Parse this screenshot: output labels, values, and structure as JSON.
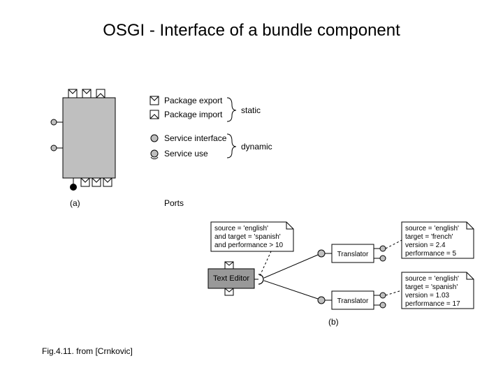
{
  "title": "OSGI - Interface of a bundle component",
  "legend": {
    "pkg_export": "Package export",
    "pkg_import": "Package import",
    "svc_interface": "Service interface",
    "svc_use": "Service use",
    "static": "static",
    "dynamic": "dynamic"
  },
  "labels": {
    "a": "(a)",
    "b": "(b)",
    "ports": "Ports"
  },
  "boxes": {
    "texteditor": "Text Editor",
    "translator": "Translator"
  },
  "notes": {
    "n1l1": "source = 'english'",
    "n1l2": "and target = 'spanish'",
    "n1l3": "and performance > 10",
    "n2l1": "source = 'english'",
    "n2l2": "target = 'french'",
    "n2l3": "version = 2.4",
    "n2l4": "performance = 5",
    "n3l1": "source = 'english'",
    "n3l2": "target = 'spanish'",
    "n3l3": "version = 1.03",
    "n3l4": "performance = 17"
  },
  "footer": "Fig.4.11. from [Crnkovic]"
}
